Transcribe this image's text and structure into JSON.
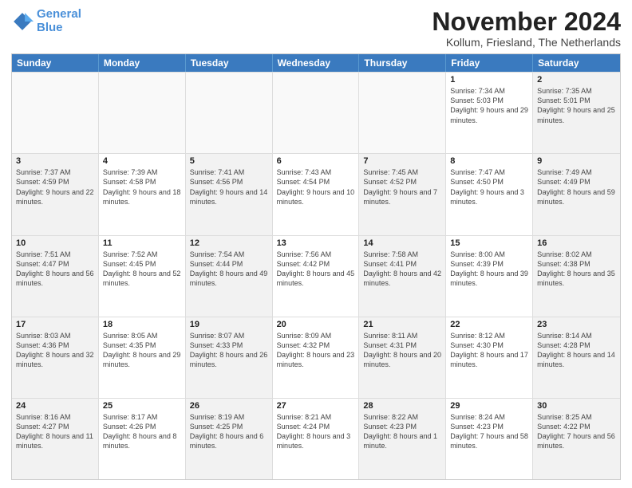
{
  "logo": {
    "line1": "General",
    "line2": "Blue"
  },
  "title": "November 2024",
  "subtitle": "Kollum, Friesland, The Netherlands",
  "header_days": [
    "Sunday",
    "Monday",
    "Tuesday",
    "Wednesday",
    "Thursday",
    "Friday",
    "Saturday"
  ],
  "rows": [
    [
      {
        "day": "",
        "info": "",
        "empty": true
      },
      {
        "day": "",
        "info": "",
        "empty": true
      },
      {
        "day": "",
        "info": "",
        "empty": true
      },
      {
        "day": "",
        "info": "",
        "empty": true
      },
      {
        "day": "",
        "info": "",
        "empty": true
      },
      {
        "day": "1",
        "info": "Sunrise: 7:34 AM\nSunset: 5:03 PM\nDaylight: 9 hours and 29 minutes."
      },
      {
        "day": "2",
        "info": "Sunrise: 7:35 AM\nSunset: 5:01 PM\nDaylight: 9 hours and 25 minutes.",
        "shaded": true
      }
    ],
    [
      {
        "day": "3",
        "info": "Sunrise: 7:37 AM\nSunset: 4:59 PM\nDaylight: 9 hours and 22 minutes.",
        "shaded": true
      },
      {
        "day": "4",
        "info": "Sunrise: 7:39 AM\nSunset: 4:58 PM\nDaylight: 9 hours and 18 minutes."
      },
      {
        "day": "5",
        "info": "Sunrise: 7:41 AM\nSunset: 4:56 PM\nDaylight: 9 hours and 14 minutes.",
        "shaded": true
      },
      {
        "day": "6",
        "info": "Sunrise: 7:43 AM\nSunset: 4:54 PM\nDaylight: 9 hours and 10 minutes."
      },
      {
        "day": "7",
        "info": "Sunrise: 7:45 AM\nSunset: 4:52 PM\nDaylight: 9 hours and 7 minutes.",
        "shaded": true
      },
      {
        "day": "8",
        "info": "Sunrise: 7:47 AM\nSunset: 4:50 PM\nDaylight: 9 hours and 3 minutes."
      },
      {
        "day": "9",
        "info": "Sunrise: 7:49 AM\nSunset: 4:49 PM\nDaylight: 8 hours and 59 minutes.",
        "shaded": true
      }
    ],
    [
      {
        "day": "10",
        "info": "Sunrise: 7:51 AM\nSunset: 4:47 PM\nDaylight: 8 hours and 56 minutes.",
        "shaded": true
      },
      {
        "day": "11",
        "info": "Sunrise: 7:52 AM\nSunset: 4:45 PM\nDaylight: 8 hours and 52 minutes."
      },
      {
        "day": "12",
        "info": "Sunrise: 7:54 AM\nSunset: 4:44 PM\nDaylight: 8 hours and 49 minutes.",
        "shaded": true
      },
      {
        "day": "13",
        "info": "Sunrise: 7:56 AM\nSunset: 4:42 PM\nDaylight: 8 hours and 45 minutes."
      },
      {
        "day": "14",
        "info": "Sunrise: 7:58 AM\nSunset: 4:41 PM\nDaylight: 8 hours and 42 minutes.",
        "shaded": true
      },
      {
        "day": "15",
        "info": "Sunrise: 8:00 AM\nSunset: 4:39 PM\nDaylight: 8 hours and 39 minutes."
      },
      {
        "day": "16",
        "info": "Sunrise: 8:02 AM\nSunset: 4:38 PM\nDaylight: 8 hours and 35 minutes.",
        "shaded": true
      }
    ],
    [
      {
        "day": "17",
        "info": "Sunrise: 8:03 AM\nSunset: 4:36 PM\nDaylight: 8 hours and 32 minutes.",
        "shaded": true
      },
      {
        "day": "18",
        "info": "Sunrise: 8:05 AM\nSunset: 4:35 PM\nDaylight: 8 hours and 29 minutes."
      },
      {
        "day": "19",
        "info": "Sunrise: 8:07 AM\nSunset: 4:33 PM\nDaylight: 8 hours and 26 minutes.",
        "shaded": true
      },
      {
        "day": "20",
        "info": "Sunrise: 8:09 AM\nSunset: 4:32 PM\nDaylight: 8 hours and 23 minutes."
      },
      {
        "day": "21",
        "info": "Sunrise: 8:11 AM\nSunset: 4:31 PM\nDaylight: 8 hours and 20 minutes.",
        "shaded": true
      },
      {
        "day": "22",
        "info": "Sunrise: 8:12 AM\nSunset: 4:30 PM\nDaylight: 8 hours and 17 minutes."
      },
      {
        "day": "23",
        "info": "Sunrise: 8:14 AM\nSunset: 4:28 PM\nDaylight: 8 hours and 14 minutes.",
        "shaded": true
      }
    ],
    [
      {
        "day": "24",
        "info": "Sunrise: 8:16 AM\nSunset: 4:27 PM\nDaylight: 8 hours and 11 minutes.",
        "shaded": true
      },
      {
        "day": "25",
        "info": "Sunrise: 8:17 AM\nSunset: 4:26 PM\nDaylight: 8 hours and 8 minutes."
      },
      {
        "day": "26",
        "info": "Sunrise: 8:19 AM\nSunset: 4:25 PM\nDaylight: 8 hours and 6 minutes.",
        "shaded": true
      },
      {
        "day": "27",
        "info": "Sunrise: 8:21 AM\nSunset: 4:24 PM\nDaylight: 8 hours and 3 minutes."
      },
      {
        "day": "28",
        "info": "Sunrise: 8:22 AM\nSunset: 4:23 PM\nDaylight: 8 hours and 1 minute.",
        "shaded": true
      },
      {
        "day": "29",
        "info": "Sunrise: 8:24 AM\nSunset: 4:23 PM\nDaylight: 7 hours and 58 minutes."
      },
      {
        "day": "30",
        "info": "Sunrise: 8:25 AM\nSunset: 4:22 PM\nDaylight: 7 hours and 56 minutes.",
        "shaded": true
      }
    ]
  ]
}
